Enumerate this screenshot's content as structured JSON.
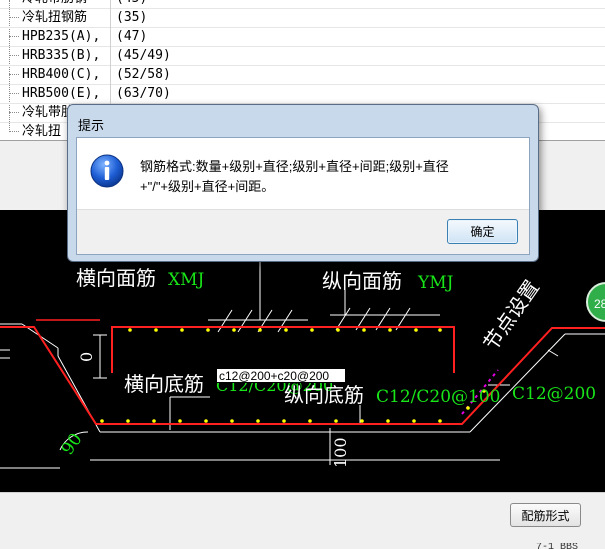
{
  "grade_list": {
    "rows": [
      {
        "name": "冷轧扭钢筋",
        "value": "(35)"
      },
      {
        "name": "HPB235(A),",
        "value": "(47)"
      },
      {
        "name": "HRB335(B),",
        "value": "(45/49)"
      },
      {
        "name": "HRB400(C),",
        "value": "(52/58)"
      },
      {
        "name": "HRB500(E),",
        "value": "(63/70)"
      },
      {
        "name": "冷轧带肋钢",
        "value": ""
      },
      {
        "name": "冷轧扭",
        "value": ""
      }
    ]
  },
  "dialog": {
    "title": "提示",
    "icon": "info-icon",
    "message_line1": "钢筋格式:数量+级别+直径;级别+直径+间距;级别+直径",
    "message_line2": "+\"/\"+级别+直径+间距。",
    "ok_label": "确定"
  },
  "drawing": {
    "label_top_horizontal": "横向面筋",
    "label_top_horizontal_code": "XMJ",
    "label_top_longitudinal": "纵向面筋",
    "label_top_longitudinal_code": "YMJ",
    "label_bottom_horizontal": "横向底筋",
    "label_bottom_horizontal_value": "C12/C20@200",
    "label_bottom_longitudinal": "纵向底筋",
    "label_bottom_longitudinal_value": "C12/C20@100",
    "label_slope_value": "C12@200",
    "label_node_settings": "节点设置",
    "dim_zero": "0",
    "dim_angle": "90",
    "dim_depth": "100",
    "formula_input": "c12@200+c20@200"
  },
  "bottom_bar": {
    "stirrup_button": "配筋形式",
    "status_fragment": "7-1 BBS"
  },
  "corner_badge": "28",
  "colors": {
    "cad_background": "#000000",
    "cad_white": "#ffffff",
    "cad_red": "#ff2020",
    "cad_green": "#19e619",
    "cad_yellow": "#ffff00",
    "cad_magenta": "#e600e6",
    "dialog_frame": "#c9d9ec"
  }
}
